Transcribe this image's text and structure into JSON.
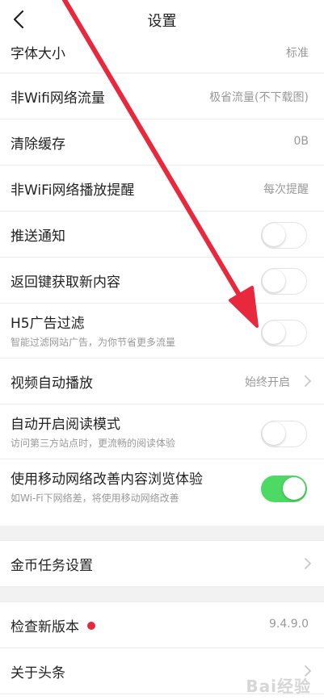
{
  "header": {
    "title": "设置"
  },
  "settings": [
    {
      "label": "字体大小",
      "value": "标准"
    },
    {
      "label": "非Wifi网络流量",
      "value": "极省流量(不下载图)"
    },
    {
      "label": "清除缓存",
      "value": "0B"
    },
    {
      "label": "非WiFi网络播放提醒",
      "value": "每次提醒"
    },
    {
      "label": "推送通知",
      "toggle": false
    },
    {
      "label": "返回键获取新内容",
      "toggle": false
    },
    {
      "label": "H5广告过滤",
      "sub": "智能过滤网站广告，为你节省更多流量",
      "toggle": false
    },
    {
      "label": "视频自动播放",
      "value": "始终开启"
    },
    {
      "label": "自动开启阅读模式",
      "sub": "访问第三方站点时，更流畅的阅读体验",
      "toggle": false
    },
    {
      "label": "使用移动网络改善内容浏览体验",
      "sub": "如Wi-Fi下网络差，将使用移动网络改善",
      "toggle": true
    }
  ],
  "coin_tasks": {
    "label": "金币任务设置"
  },
  "check_update": {
    "label": "检查新版本",
    "value": "9.4.9.0"
  },
  "about": {
    "label": "关于头条"
  },
  "watermark": {
    "text": "Bai经验"
  },
  "colors": {
    "toggle_on": "#4cd964",
    "arrow": "#e8283c",
    "badge": "#e8283c"
  }
}
